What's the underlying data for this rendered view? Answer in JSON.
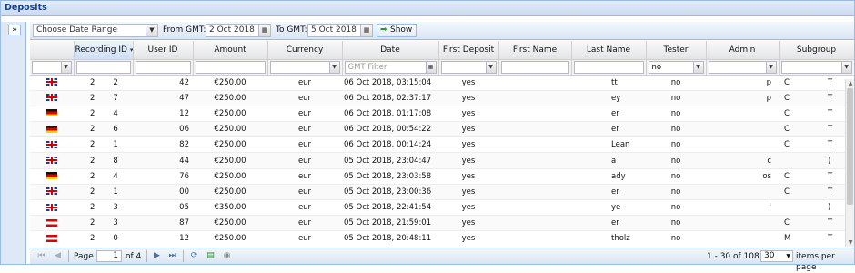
{
  "panel": {
    "title": "Deposits",
    "expand_glyph": "»"
  },
  "toolbar": {
    "date_range_placeholder": "Choose Date Range",
    "from_label": "From GMT:",
    "from_value": "2 Oct 2018",
    "to_label": "To GMT:",
    "to_value": "5 Oct 2018",
    "show_label": "Show"
  },
  "columns": [
    "",
    "Recording ID",
    "User ID",
    "Amount",
    "Currency",
    "Date",
    "First Deposit",
    "First Name",
    "Last Name",
    "Tester",
    "Admin",
    "Subgroup"
  ],
  "filters": {
    "date_placeholder": "GMT Filter",
    "tester_value": "no"
  },
  "rows": [
    {
      "flag": "uk",
      "a": "2",
      "rid": "2",
      "uid": "42",
      "amount": "€250.00",
      "currency": "eur",
      "date": "06 Oct 2018, 03:15:04",
      "fd": "yes",
      "fname": "",
      "lname": "tt",
      "tester": "no",
      "admin": "p",
      "sub": "C",
      "extra": "T"
    },
    {
      "flag": "uk",
      "a": "2",
      "rid": "7",
      "uid": "47",
      "amount": "€250.00",
      "currency": "eur",
      "date": "06 Oct 2018, 02:37:17",
      "fd": "yes",
      "fname": "",
      "lname": "ey",
      "tester": "no",
      "admin": "p",
      "sub": "C",
      "extra": "T"
    },
    {
      "flag": "de",
      "a": "2",
      "rid": "4",
      "uid": "12",
      "amount": "€250.00",
      "currency": "eur",
      "date": "06 Oct 2018, 01:17:08",
      "fd": "yes",
      "fname": "",
      "lname": "er",
      "tester": "no",
      "admin": "",
      "sub": "C",
      "extra": "T"
    },
    {
      "flag": "de",
      "a": "2",
      "rid": "6",
      "uid": "06",
      "amount": "€250.00",
      "currency": "eur",
      "date": "06 Oct 2018, 00:54:22",
      "fd": "yes",
      "fname": "",
      "lname": "er",
      "tester": "no",
      "admin": "",
      "sub": "C",
      "extra": "T"
    },
    {
      "flag": "uk",
      "a": "2",
      "rid": "1",
      "uid": "82",
      "amount": "€250.00",
      "currency": "eur",
      "date": "06 Oct 2018, 00:14:24",
      "fd": "yes",
      "fname": "",
      "lname": "Lean",
      "tester": "no",
      "admin": "",
      "sub": "C",
      "extra": "T"
    },
    {
      "flag": "uk",
      "a": "2",
      "rid": "8",
      "uid": "44",
      "amount": "€250.00",
      "currency": "eur",
      "date": "05 Oct 2018, 23:04:47",
      "fd": "yes",
      "fname": "",
      "lname": "a",
      "tester": "no",
      "admin": "c",
      "sub": "",
      "extra": ")"
    },
    {
      "flag": "de",
      "a": "2",
      "rid": "4",
      "uid": "76",
      "amount": "€250.00",
      "currency": "eur",
      "date": "05 Oct 2018, 23:03:58",
      "fd": "yes",
      "fname": "",
      "lname": "ady",
      "tester": "no",
      "admin": "os",
      "sub": "C",
      "extra": "T"
    },
    {
      "flag": "uk",
      "a": "2",
      "rid": "1",
      "uid": "00",
      "amount": "€250.00",
      "currency": "eur",
      "date": "05 Oct 2018, 23:00:36",
      "fd": "yes",
      "fname": "",
      "lname": "er",
      "tester": "no",
      "admin": "",
      "sub": "C",
      "extra": "T"
    },
    {
      "flag": "uk",
      "a": "2",
      "rid": "3",
      "uid": "05",
      "amount": "€350.00",
      "currency": "eur",
      "date": "05 Oct 2018, 22:41:54",
      "fd": "yes",
      "fname": "",
      "lname": "ye",
      "tester": "no",
      "admin": "'",
      "sub": "",
      "extra": ")"
    },
    {
      "flag": "at",
      "a": "2",
      "rid": "3",
      "uid": "87",
      "amount": "€250.00",
      "currency": "eur",
      "date": "05 Oct 2018, 21:59:01",
      "fd": "yes",
      "fname": "",
      "lname": "er",
      "tester": "no",
      "admin": "",
      "sub": "C",
      "extra": "T"
    },
    {
      "flag": "at",
      "a": "2",
      "rid": "0",
      "uid": "12",
      "amount": "€250.00",
      "currency": "eur",
      "date": "05 Oct 2018, 20:48:11",
      "fd": "yes",
      "fname": "",
      "lname": "tholz",
      "tester": "no",
      "admin": "",
      "sub": "M",
      "extra": "T"
    }
  ],
  "pager": {
    "page_label": "Page",
    "page_value": "1",
    "of_label": "of 4",
    "summary": "1 - 30 of 108",
    "per_page_value": "30",
    "per_page_label": "items per page"
  }
}
